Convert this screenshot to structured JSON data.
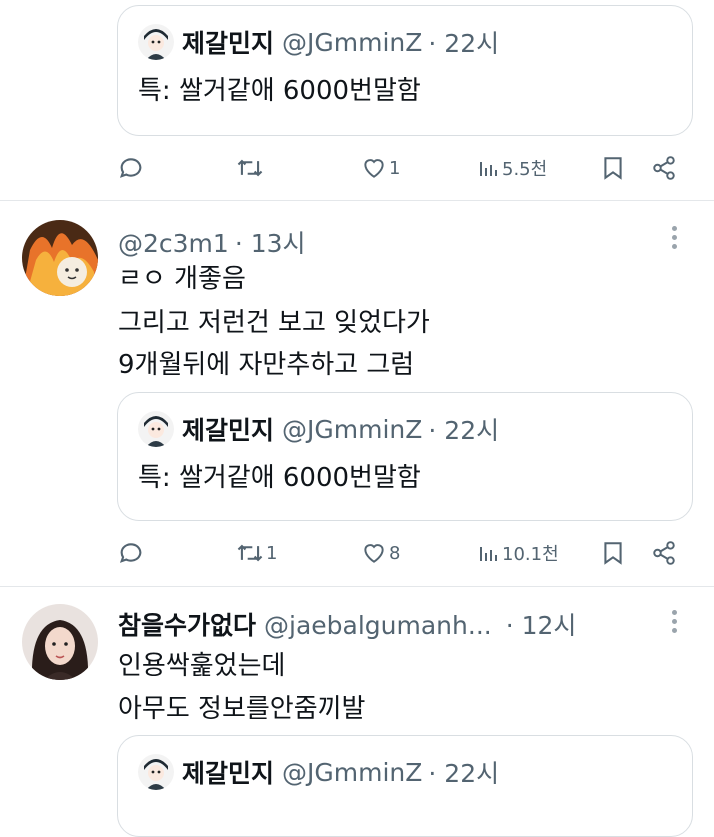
{
  "quoted": {
    "name": "제갈민지",
    "handle": "@JGmminZ",
    "time": "· 22시",
    "text": "특: 쌀거같애 6000번말함"
  },
  "tweets": [
    {
      "actions": {
        "reply": "",
        "retweet": "",
        "like": "1",
        "views": "5.5천"
      }
    },
    {
      "name": "",
      "handle": "@2c3m1",
      "time": "· 13시",
      "lines": [
        "ㄹㅇ 개좋음",
        "그리고 저런건 보고 잊었다가",
        "9개월뒤에 자만추하고 그럼"
      ],
      "actions": {
        "reply": "",
        "retweet": "1",
        "like": "8",
        "views": "10.1천"
      }
    },
    {
      "name": "참을수가없다",
      "handle": "@jaebalgumanh...",
      "time": "· 12시",
      "lines": [
        "인용싹훑었는데",
        "아무도 정보를안줌끼발"
      ]
    }
  ],
  "icons": {
    "reply": "speech-bubble-icon",
    "retweet": "retweet-arrows-icon",
    "like": "heart-icon",
    "views": "bar-chart-icon",
    "bookmark": "bookmark-icon",
    "share": "share-icon",
    "more": "more-vertical-icon"
  },
  "colors": {
    "text": "#0f1419",
    "secondary": "#536471",
    "border": "#d9dee2"
  }
}
